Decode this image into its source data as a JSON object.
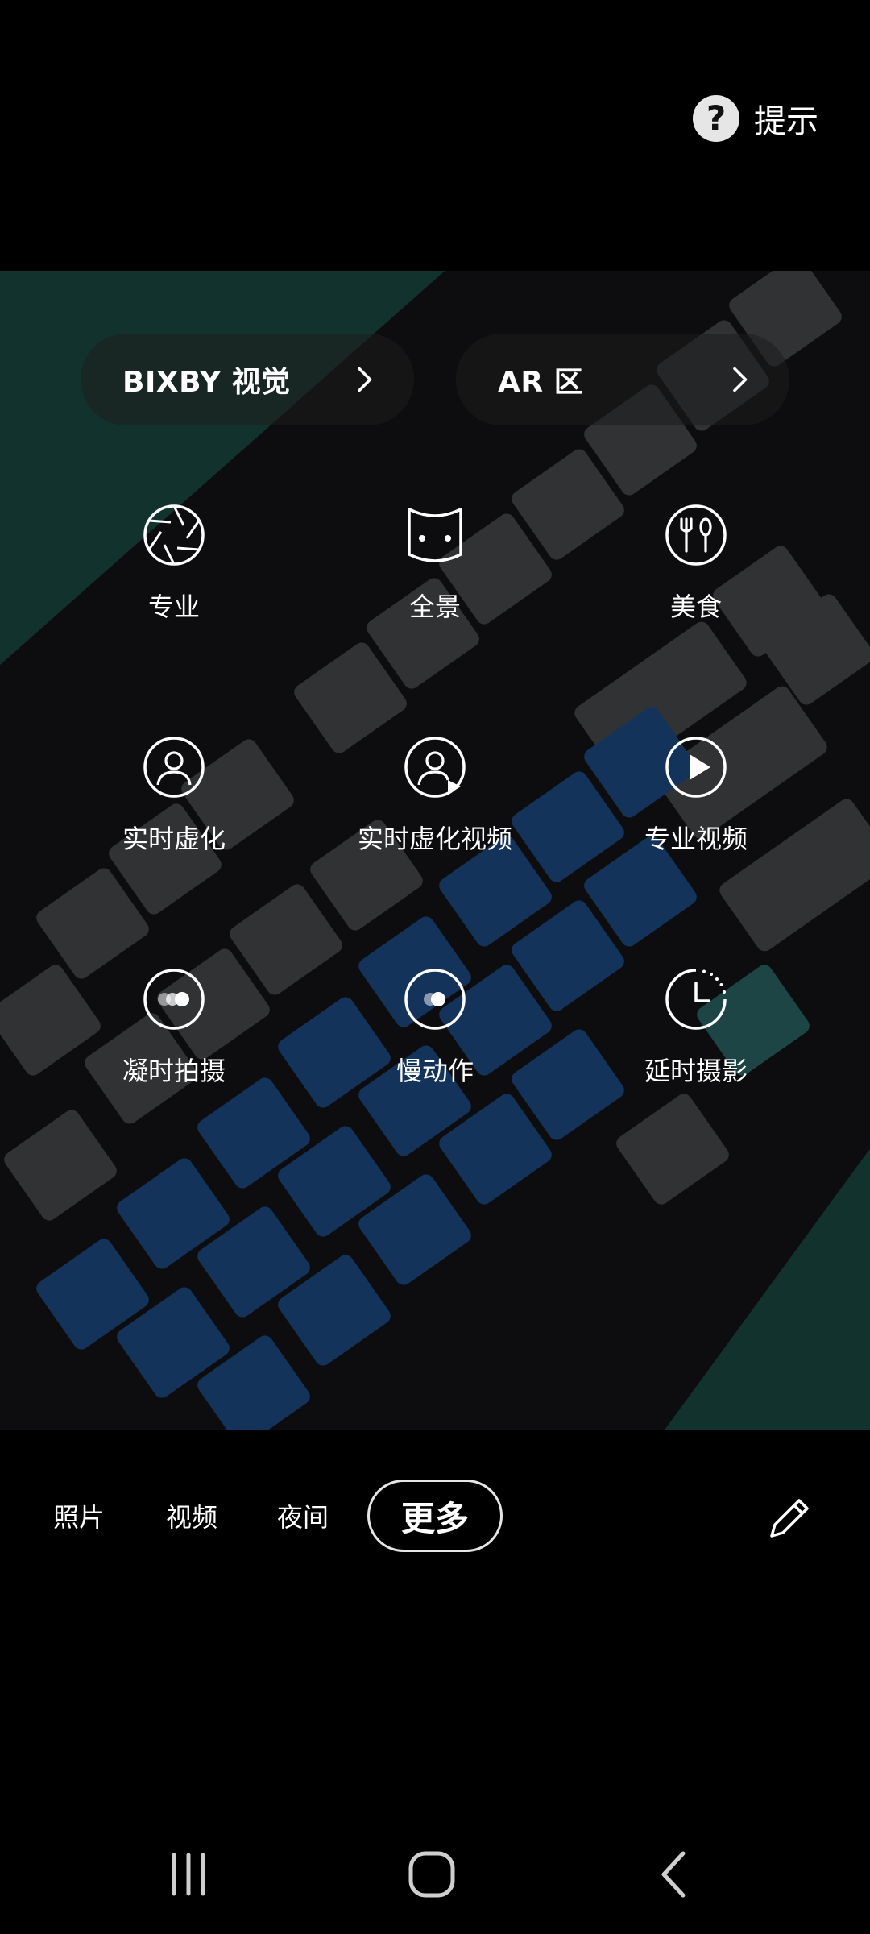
{
  "hint": {
    "label": "提示",
    "icon": "question-circle-icon"
  },
  "shortcuts": [
    {
      "label": "BIXBY 视觉",
      "icon": "chevron-right-icon"
    },
    {
      "label": "AR 区",
      "icon": "chevron-right-icon"
    }
  ],
  "modes": [
    {
      "label": "专业",
      "icon": "aperture-icon"
    },
    {
      "label": "全景",
      "icon": "panorama-icon"
    },
    {
      "label": "美食",
      "icon": "food-icon"
    },
    {
      "label": "实时虚化",
      "icon": "portrait-icon"
    },
    {
      "label": "实时虚化视频",
      "icon": "portrait-video-icon"
    },
    {
      "label": "专业视频",
      "icon": "pro-video-icon"
    },
    {
      "label": "凝时拍摄",
      "icon": "hyperlapse-icon"
    },
    {
      "label": "慢动作",
      "icon": "slow-motion-icon"
    },
    {
      "label": "延时摄影",
      "icon": "timelapse-icon"
    }
  ],
  "mode_bar": {
    "tabs": [
      "照片",
      "视频",
      "夜间",
      "更多"
    ],
    "active": "更多",
    "edit_icon": "pencil-icon"
  },
  "navigation": {
    "recents_icon": "recents-icon",
    "home_icon": "home-icon",
    "back_icon": "back-icon"
  },
  "colors": {
    "background": "#000000",
    "text": "#ffffff",
    "active_outline": "#e6e6e6"
  }
}
